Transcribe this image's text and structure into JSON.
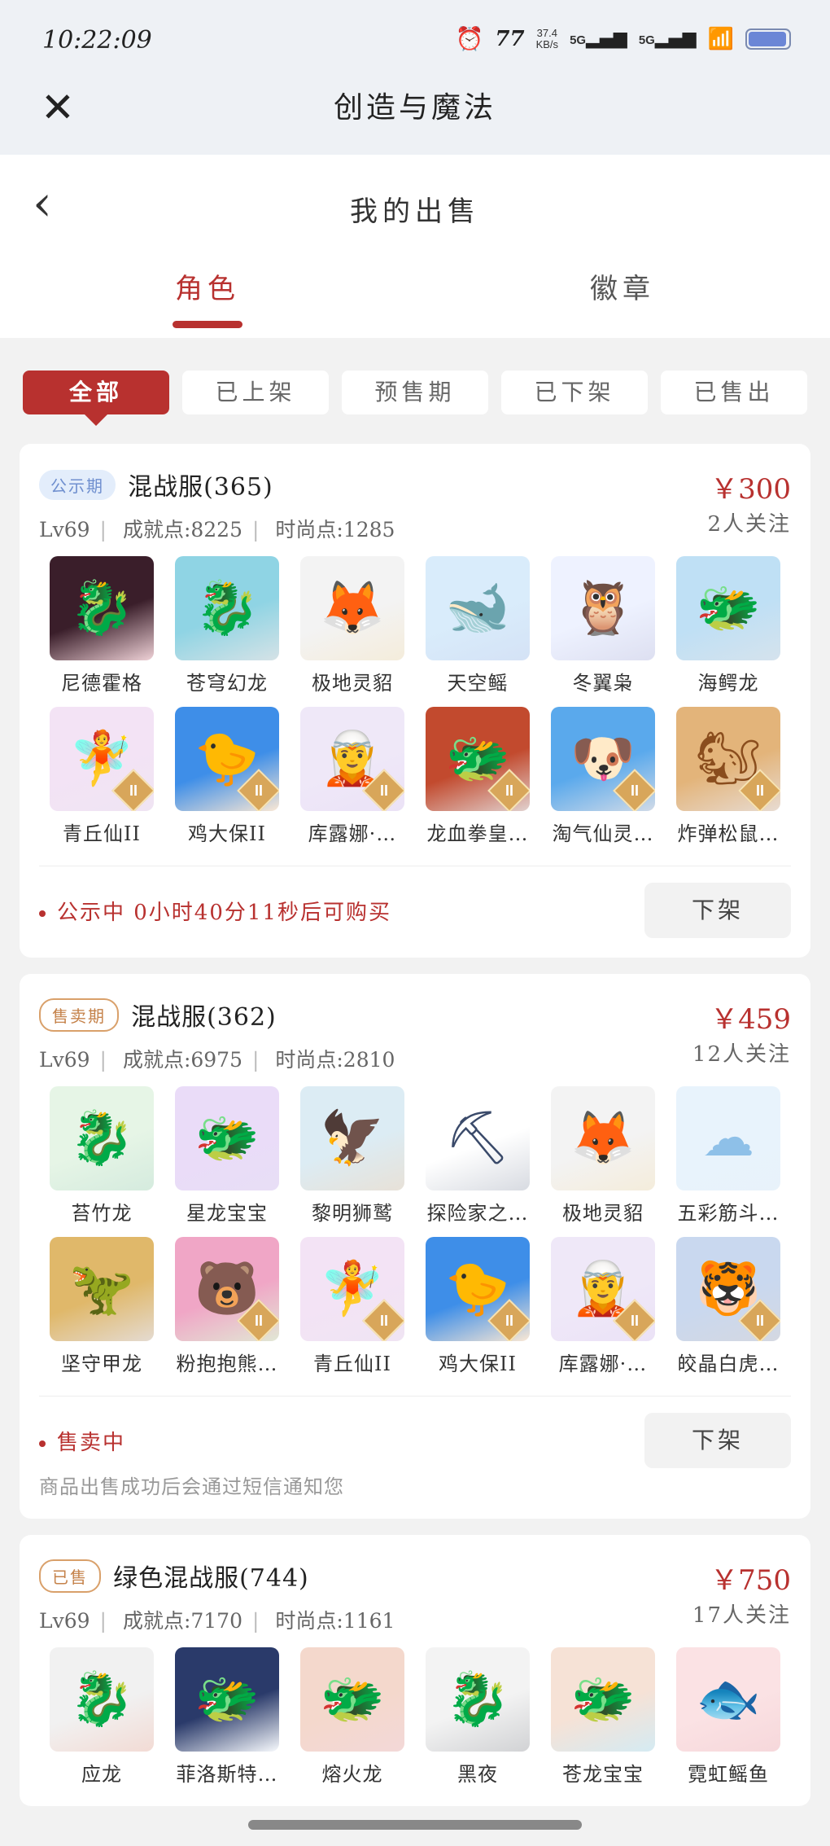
{
  "status_bar": {
    "time": "10:22:09",
    "net_speed": "37.4\nKB/s",
    "signal_1": "5G",
    "signal_2": "5G"
  },
  "app": {
    "title": "创造与魔法",
    "close_icon": "close-icon"
  },
  "page": {
    "title": "我的出售",
    "back_icon": "chevron-left-icon",
    "tabs": [
      {
        "label": "角色",
        "active": true
      },
      {
        "label": "徽章",
        "active": false
      }
    ],
    "filters": [
      {
        "label": "全部",
        "active": true
      },
      {
        "label": "已上架",
        "active": false
      },
      {
        "label": "预售期",
        "active": false
      },
      {
        "label": "已下架",
        "active": false
      },
      {
        "label": "已售出",
        "active": false
      }
    ]
  },
  "colors": {
    "accent": "#b8312f",
    "badge_blue": "#6f8fcf",
    "badge_orange": "#c5824a"
  },
  "listings": [
    {
      "badge": "公示期",
      "name": "混战服(365)",
      "price": "￥300",
      "stats": {
        "level": "Lv69",
        "achievement": "成就点:8225",
        "fashion": "时尚点:1285"
      },
      "watchers": "2人关注",
      "pets": [
        {
          "name": "尼德霍格",
          "icon": "black-dragon-icon"
        },
        {
          "name": "苍穹幻龙",
          "icon": "teal-dragon-icon"
        },
        {
          "name": "极地灵貂",
          "icon": "white-fox-icon"
        },
        {
          "name": "天空鳐",
          "icon": "sky-ray-icon"
        },
        {
          "name": "冬翼枭",
          "icon": "snow-owl-icon"
        },
        {
          "name": "海鳄龙",
          "icon": "sea-dragon-icon"
        },
        {
          "name": "青丘仙II",
          "icon": "fox-fairy-icon"
        },
        {
          "name": "鸡大保II",
          "icon": "blue-chicken-icon"
        },
        {
          "name": "库露娜·…",
          "icon": "fairy-girl-icon"
        },
        {
          "name": "龙血拳皇…",
          "icon": "red-beast-icon"
        },
        {
          "name": "淘气仙灵…",
          "icon": "blue-pup-icon"
        },
        {
          "name": "炸弹松鼠…",
          "icon": "squirrel-icon"
        }
      ],
      "status": "公示中 0小时40分11秒后可购买",
      "note": "",
      "action": "下架"
    },
    {
      "badge": "售卖期",
      "name": "混战服(362)",
      "price": "￥459",
      "stats": {
        "level": "Lv69",
        "achievement": "成就点:6975",
        "fashion": "时尚点:2810"
      },
      "watchers": "12人关注",
      "pets": [
        {
          "name": "苔竹龙",
          "icon": "green-dragon-icon"
        },
        {
          "name": "星龙宝宝",
          "icon": "star-dragon-icon"
        },
        {
          "name": "黎明狮鹫",
          "icon": "griffin-icon"
        },
        {
          "name": "探险家之…",
          "icon": "shovel-icon"
        },
        {
          "name": "极地灵貂",
          "icon": "white-fox-icon"
        },
        {
          "name": "五彩筋斗…",
          "icon": "cloud-icon"
        },
        {
          "name": "坚守甲龙",
          "icon": "armored-dragon-icon"
        },
        {
          "name": "粉抱抱熊…",
          "icon": "pink-bear-icon"
        },
        {
          "name": "青丘仙II",
          "icon": "fox-fairy-icon"
        },
        {
          "name": "鸡大保II",
          "icon": "blue-chicken-icon"
        },
        {
          "name": "库露娜·…",
          "icon": "fairy-girl-icon"
        },
        {
          "name": "皎晶白虎…",
          "icon": "white-tiger-icon"
        }
      ],
      "status": "售卖中",
      "note": "商品出售成功后会通过短信通知您",
      "action": "下架"
    },
    {
      "badge": "已售",
      "name": "绿色混战服(744)",
      "price": "￥750",
      "stats": {
        "level": "Lv69",
        "achievement": "成就点:7170",
        "fashion": "时尚点:1161"
      },
      "watchers": "17人关注",
      "pets": [
        {
          "name": "应龙",
          "icon": "ying-dragon-icon"
        },
        {
          "name": "菲洛斯特…",
          "icon": "ice-dragon-icon"
        },
        {
          "name": "熔火龙",
          "icon": "lava-dragon-icon"
        },
        {
          "name": "黑夜",
          "icon": "night-fury-icon"
        },
        {
          "name": "苍龙宝宝",
          "icon": "baby-dragon-icon"
        },
        {
          "name": "霓虹鳐鱼",
          "icon": "neon-ray-icon"
        }
      ],
      "status": "",
      "note": "",
      "action": ""
    }
  ]
}
